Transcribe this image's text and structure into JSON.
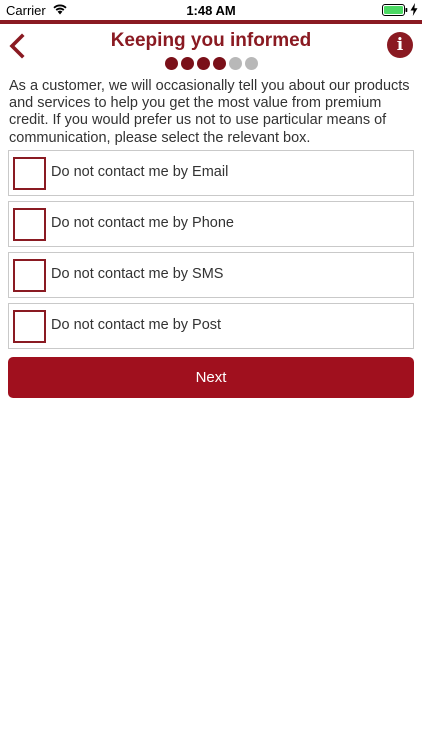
{
  "status_bar": {
    "carrier": "Carrier",
    "time": "1:48 AM"
  },
  "header": {
    "title": "Keeping you informed",
    "info_label": "i",
    "back_icon": "chevron-left-icon",
    "progress": {
      "filled": 4,
      "total": 6
    }
  },
  "intro": {
    "text": "As a customer, we will occasionally tell you about our products and services to help you get the most value from premium credit. If you would prefer us not to use particular means of communication, please select the relevant box."
  },
  "options": [
    {
      "label": "Do not contact me by Email",
      "checked": false
    },
    {
      "label": "Do not contact me by Phone",
      "checked": false
    },
    {
      "label": "Do not contact me by SMS",
      "checked": false
    },
    {
      "label": "Do not contact me by Post",
      "checked": false
    }
  ],
  "next_button": {
    "label": "Next"
  },
  "colors": {
    "brand": "#8a1a22",
    "button": "#a0101e",
    "dot_empty": "#b8b8b8"
  }
}
